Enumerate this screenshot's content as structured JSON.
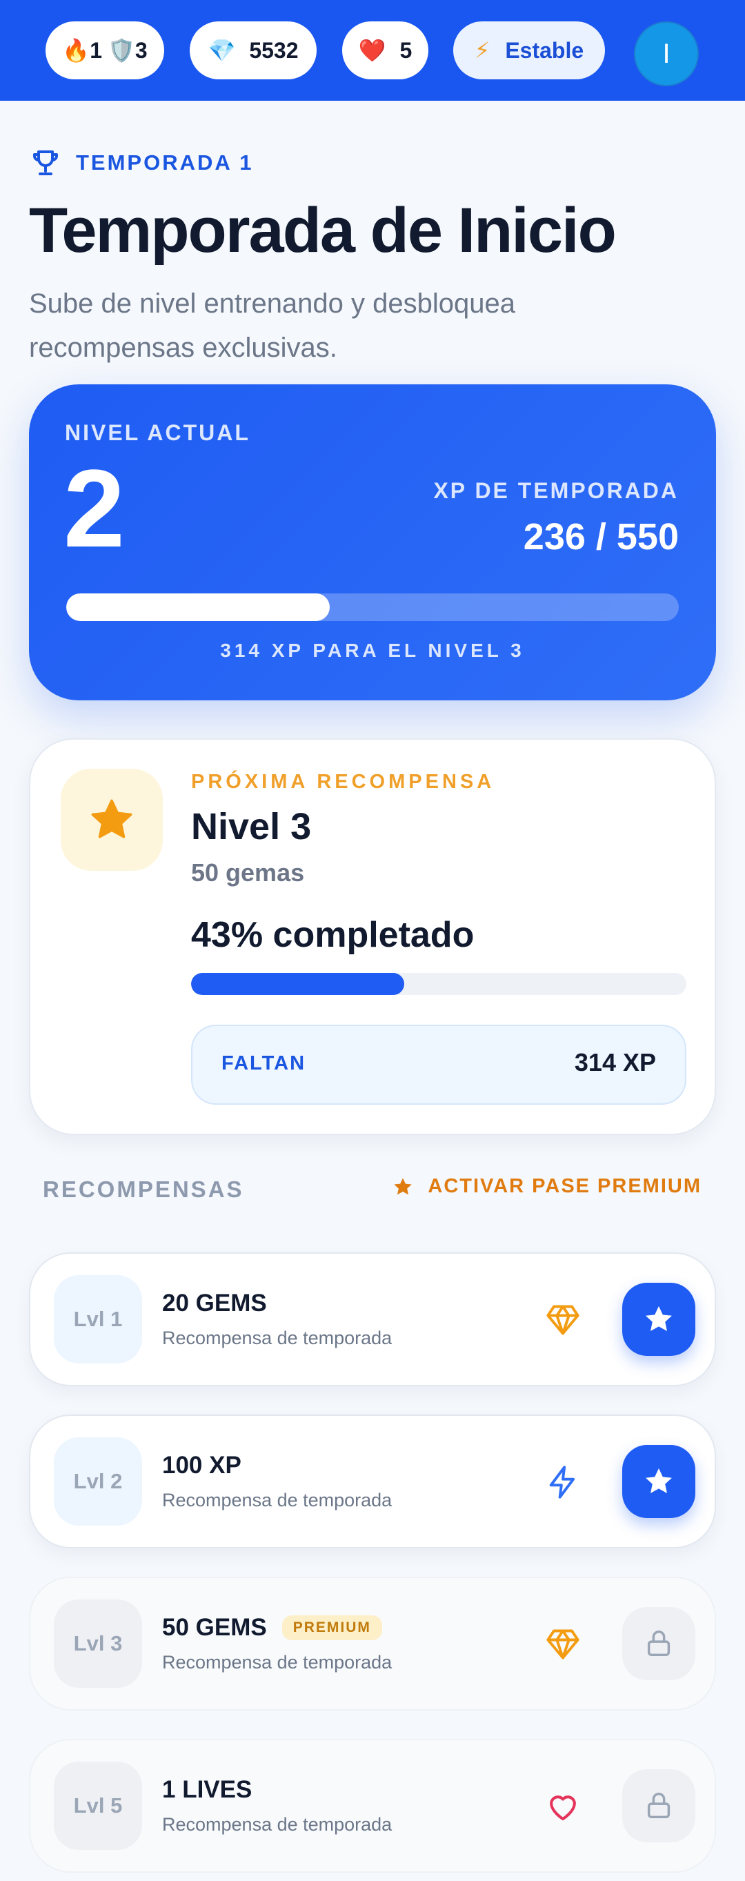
{
  "topbar": {
    "streak": {
      "fire_icon": "🔥",
      "fire_count": "1",
      "shield_icon": "🛡️",
      "shield_count": "3"
    },
    "gems": {
      "icon": "💎",
      "value": "5532"
    },
    "lives": {
      "icon": "❤️",
      "value": "5"
    },
    "energy": {
      "icon": "⚡",
      "label": "Estable"
    },
    "avatar_initial": "I"
  },
  "header": {
    "season_label": "TEMPORADA 1",
    "title": "Temporada de Inicio",
    "subtitle": "Sube de nivel entrenando y desbloquea recompensas exclusivas."
  },
  "level_card": {
    "label": "NIVEL ACTUAL",
    "level": "2",
    "xp_label": "XP DE TEMPORADA",
    "xp_value": "236 / 550",
    "progress": 0.43,
    "remaining_text": "314 XP PARA EL NIVEL 3"
  },
  "next_reward": {
    "label": "PRÓXIMA RECOMPENSA",
    "title": "Nivel 3",
    "subtitle": "50 gemas",
    "percent_text": "43% completado",
    "progress": 0.43,
    "missing_label": "FALTAN",
    "missing_value": "314 XP"
  },
  "rewards_section": {
    "title": "RECOMPENSAS",
    "premium_cta": "ACTIVAR PASE PREMIUM"
  },
  "rewards": [
    {
      "level": "Lvl 1",
      "name": "20 GEMS",
      "desc": "Recompensa de temporada",
      "premium_tag": "",
      "icon": "gem-icon",
      "state": "claim"
    },
    {
      "level": "Lvl 2",
      "name": "100 XP",
      "desc": "Recompensa de temporada",
      "premium_tag": "",
      "icon": "bolt-icon",
      "state": "claim"
    },
    {
      "level": "Lvl 3",
      "name": "50 GEMS",
      "desc": "Recompensa de temporada",
      "premium_tag": "PREMIUM",
      "icon": "gem-icon",
      "state": "locked"
    },
    {
      "level": "Lvl 5",
      "name": "1 LIVES",
      "desc": "Recompensa de temporada",
      "premium_tag": "",
      "icon": "heart-icon",
      "state": "locked"
    }
  ],
  "colors": {
    "brand": "#1a56f0",
    "accent_orange": "#f0a02a",
    "premium_orange": "#e07b10"
  }
}
